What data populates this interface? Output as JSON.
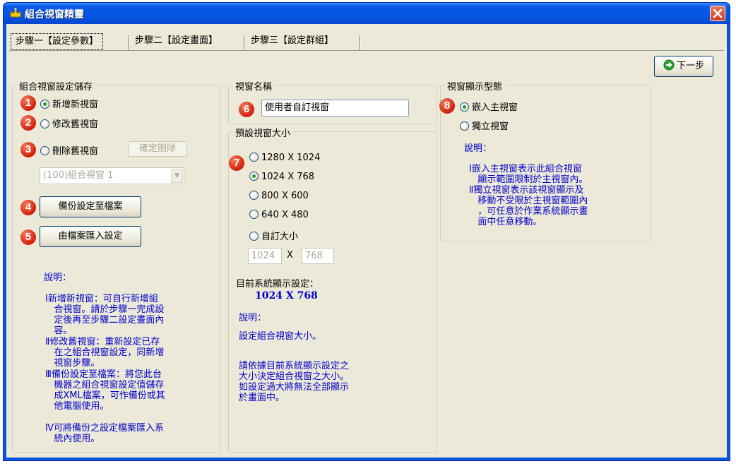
{
  "window": {
    "title": "組合視窗精靈",
    "accent": "#0a55e3"
  },
  "tabs": [
    {
      "label": "步驟一【設定參數】"
    },
    {
      "label": "步驟二【設定畫面】"
    },
    {
      "label": "步驟三【設定群組】"
    }
  ],
  "next_button": {
    "label": "下一步"
  },
  "group_save": {
    "title": "組合視窗設定儲存",
    "options": [
      {
        "badge": "1",
        "label": "新增新視窗",
        "checked": true
      },
      {
        "badge": "2",
        "label": "修改舊視窗",
        "checked": false
      },
      {
        "badge": "3",
        "label": "刪除舊視窗",
        "checked": false
      }
    ],
    "confirm_delete": "確定刪除",
    "combo_value": "(100)組合視窗 1",
    "backup_badge": "4",
    "backup_button": "備份設定至檔案",
    "import_badge": "5",
    "import_button": "由檔案匯入設定",
    "note_title": "說明：",
    "notes": [
      "Ⅰ新增新視窗：可自行新增組\n   合視窗。請於步驟一完成設\n   定後再至步驟二設定畫面內\n   容。",
      "Ⅱ修改舊視窗：重新設定已存\n   在之組合視窗設定，同新增\n   視窗步驟。",
      "Ⅲ備份設定至檔案：將您此台\n   機器之組合視窗設定值儲存\n   成XML檔案，可作備份或其\n   他電腦使用。",
      "Ⅳ可將備份之設定檔案匯入系\n   統內使用。"
    ]
  },
  "group_name": {
    "title": "視窗名稱",
    "badge": "6",
    "value": "使用者自訂視窗"
  },
  "group_size": {
    "title": "預設視窗大小",
    "badge": "7",
    "options": [
      {
        "label": "1280 X 1024",
        "checked": false
      },
      {
        "label": "1024 X 768",
        "checked": true
      },
      {
        "label": "800 X 600",
        "checked": false
      },
      {
        "label": "640 X 480",
        "checked": false
      },
      {
        "label": "自訂大小",
        "checked": false
      }
    ],
    "custom_width": "1024",
    "custom_x": "X",
    "custom_height": "768",
    "current_label": "目前系統顯示設定：",
    "current_value": "1024 X 768",
    "note_title": "說明：",
    "note1": "設定組合視窗大小。",
    "note2": "請依據目前系統顯示設定之\n大小決定組合視窗之大小。\n如設定過大將無法全部顯示\n於畫面中。"
  },
  "group_type": {
    "title": "視窗顯示型態",
    "badge": "8",
    "options": [
      {
        "label": "嵌入主視窗",
        "checked": true
      },
      {
        "label": "獨立視窗",
        "checked": false
      }
    ],
    "note_title": "說明：",
    "note": "Ⅰ嵌入主視窗表示此組合視窗\n   顯示範圍限制於主視窗內。\nⅡ獨立視窗表示該視窗顯示及\n   移動不受限於主視窗範圍內\n   ，可任意於作業系統顯示畫\n   面中任意移動。"
  }
}
